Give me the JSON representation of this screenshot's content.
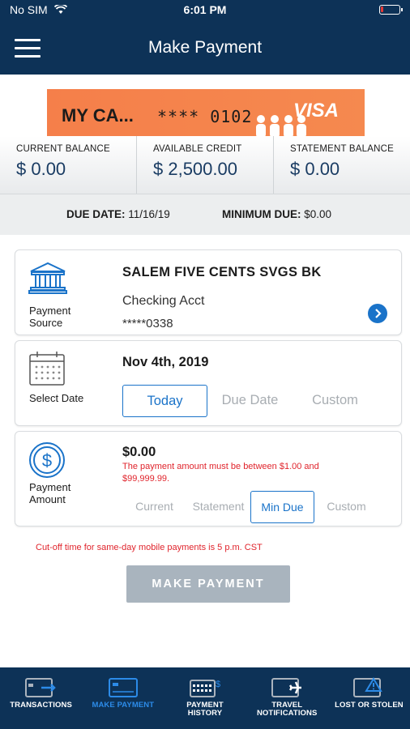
{
  "status_bar": {
    "carrier": "No SIM",
    "time": "6:01 PM"
  },
  "header": {
    "title": "Make Payment"
  },
  "card": {
    "name": "MY CA...",
    "number": "**** 0102",
    "brand": "VISA"
  },
  "balances": [
    {
      "label": "CURRENT BALANCE",
      "value": "$ 0.00"
    },
    {
      "label": "AVAILABLE CREDIT",
      "value": "$ 2,500.00"
    },
    {
      "label": "STATEMENT BALANCE",
      "value": "$ 0.00"
    }
  ],
  "due": {
    "date_label": "DUE DATE:",
    "date_value": "11/16/19",
    "min_label": "MINIMUM DUE:",
    "min_value": "$0.00"
  },
  "payment_source": {
    "label_line1": "Payment",
    "label_line2": "Source",
    "bank": "SALEM FIVE CENTS SVGS BK",
    "account_type": "Checking Acct",
    "account_number": "*****0338"
  },
  "select_date": {
    "label": "Select Date",
    "date": "Nov 4th, 2019",
    "options": [
      "Today",
      "Due Date",
      "Custom"
    ],
    "selected": "Today"
  },
  "payment_amount": {
    "label_line1": "Payment",
    "label_line2": "Amount",
    "amount": "$0.00",
    "error": "The payment amount must be between $1.00 and $99,999.99.",
    "options": [
      "Current",
      "Statement",
      "Min Due",
      "Custom"
    ],
    "selected": "Min Due"
  },
  "cutoff_note": "Cut-off time for same-day mobile payments is 5 p.m. CST",
  "make_payment_button": "MAKE PAYMENT",
  "bottom_nav": [
    {
      "line1": "TRANSACTIONS",
      "line2": "",
      "icon": "card-arrow-icon",
      "active": false
    },
    {
      "line1": "MAKE PAYMENT",
      "line2": "",
      "icon": "card-icon",
      "active": true
    },
    {
      "line1": "PAYMENT",
      "line2": "HISTORY",
      "icon": "card-history-icon",
      "active": false
    },
    {
      "line1": "TRAVEL",
      "line2": "NOTIFICATIONS",
      "icon": "card-plane-icon",
      "active": false
    },
    {
      "line1": "LOST OR STOLEN",
      "line2": "",
      "icon": "card-warning-icon",
      "active": false
    }
  ],
  "colors": {
    "header_bg": "#0d3257",
    "accent": "#1a73c9",
    "error": "#e0242c",
    "card": "#f5894f"
  }
}
